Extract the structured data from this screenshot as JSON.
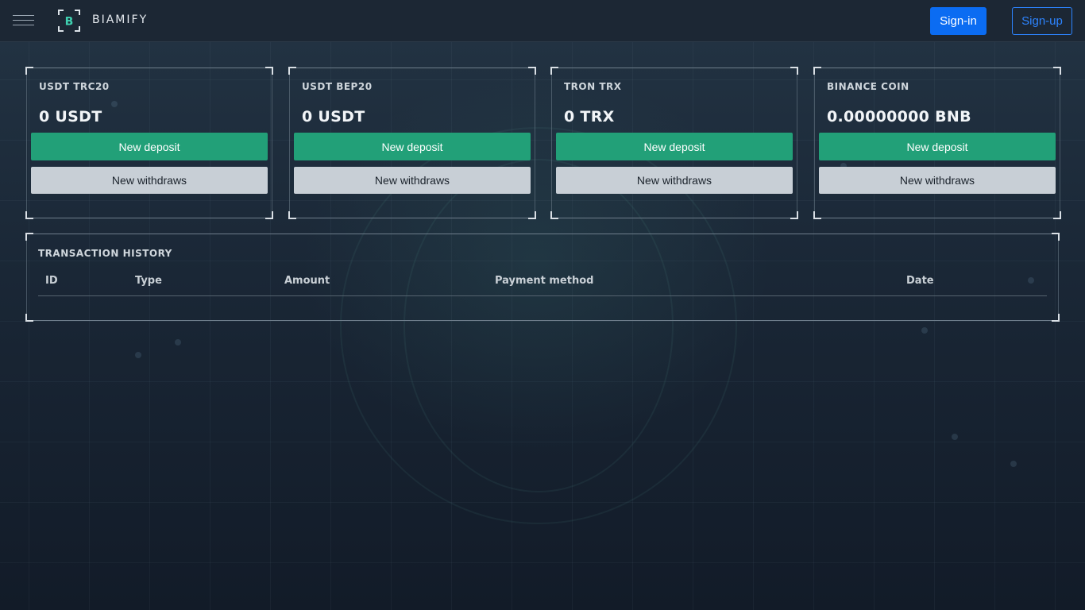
{
  "header": {
    "brand": "BIAMIFY",
    "logo_letter": "B",
    "signin_label": "Sign-in",
    "signup_label": "Sign-up"
  },
  "cards": [
    {
      "title": "USDT TRC20",
      "balance": "0 USDT",
      "deposit_label": "New deposit",
      "withdraw_label": "New withdraws"
    },
    {
      "title": "USDT BEP20",
      "balance": "0 USDT",
      "deposit_label": "New deposit",
      "withdraw_label": "New withdraws"
    },
    {
      "title": "TRON TRX",
      "balance": "0 TRX",
      "deposit_label": "New deposit",
      "withdraw_label": "New withdraws"
    },
    {
      "title": "BINANCE COIN",
      "balance": "0.00000000 BNB",
      "deposit_label": "New deposit",
      "withdraw_label": "New withdraws"
    }
  ],
  "history": {
    "title": "TRANSACTION HISTORY",
    "columns": [
      "ID",
      "Type",
      "Amount",
      "Payment method",
      "Date"
    ]
  },
  "colors": {
    "primary_blue": "#0b6cf2",
    "deposit_green": "#22a078",
    "withdraw_gray": "#c8cfd6",
    "logo_teal": "#3fd0b0"
  },
  "icons": {
    "menu": "hamburger-icon",
    "logo": "biamify-logo-icon"
  }
}
